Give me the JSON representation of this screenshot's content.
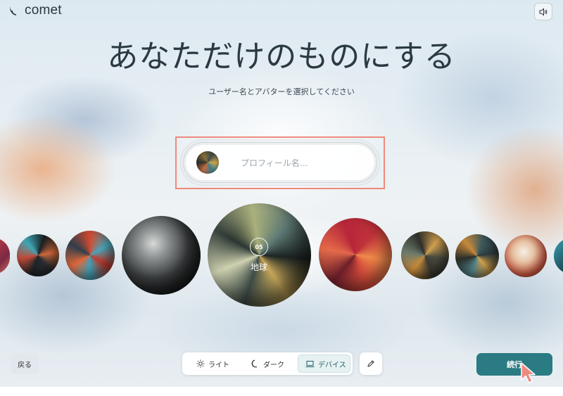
{
  "app": {
    "logo_text": "comet",
    "sound_icon": "speaker-icon"
  },
  "header": {
    "title": "あなただけのものにする",
    "subtitle": "ユーザー名とアバターを選択してください"
  },
  "profile": {
    "name_placeholder": "プロフィール名…",
    "name_value": ""
  },
  "avatar_carousel": {
    "selected": {
      "number": "05",
      "name": "地球"
    }
  },
  "footer": {
    "back_label": "戻る",
    "theme_options": [
      {
        "label": "ライト",
        "icon": "sun-icon",
        "selected": false
      },
      {
        "label": "ダーク",
        "icon": "moon-icon",
        "selected": false
      },
      {
        "label": "デバイス",
        "icon": "laptop-icon",
        "selected": true
      }
    ],
    "edit_icon": "pencil-icon",
    "continue_label": "続行"
  },
  "colors": {
    "accent": "#2a7b83",
    "highlight_border": "#ee8a7c"
  }
}
